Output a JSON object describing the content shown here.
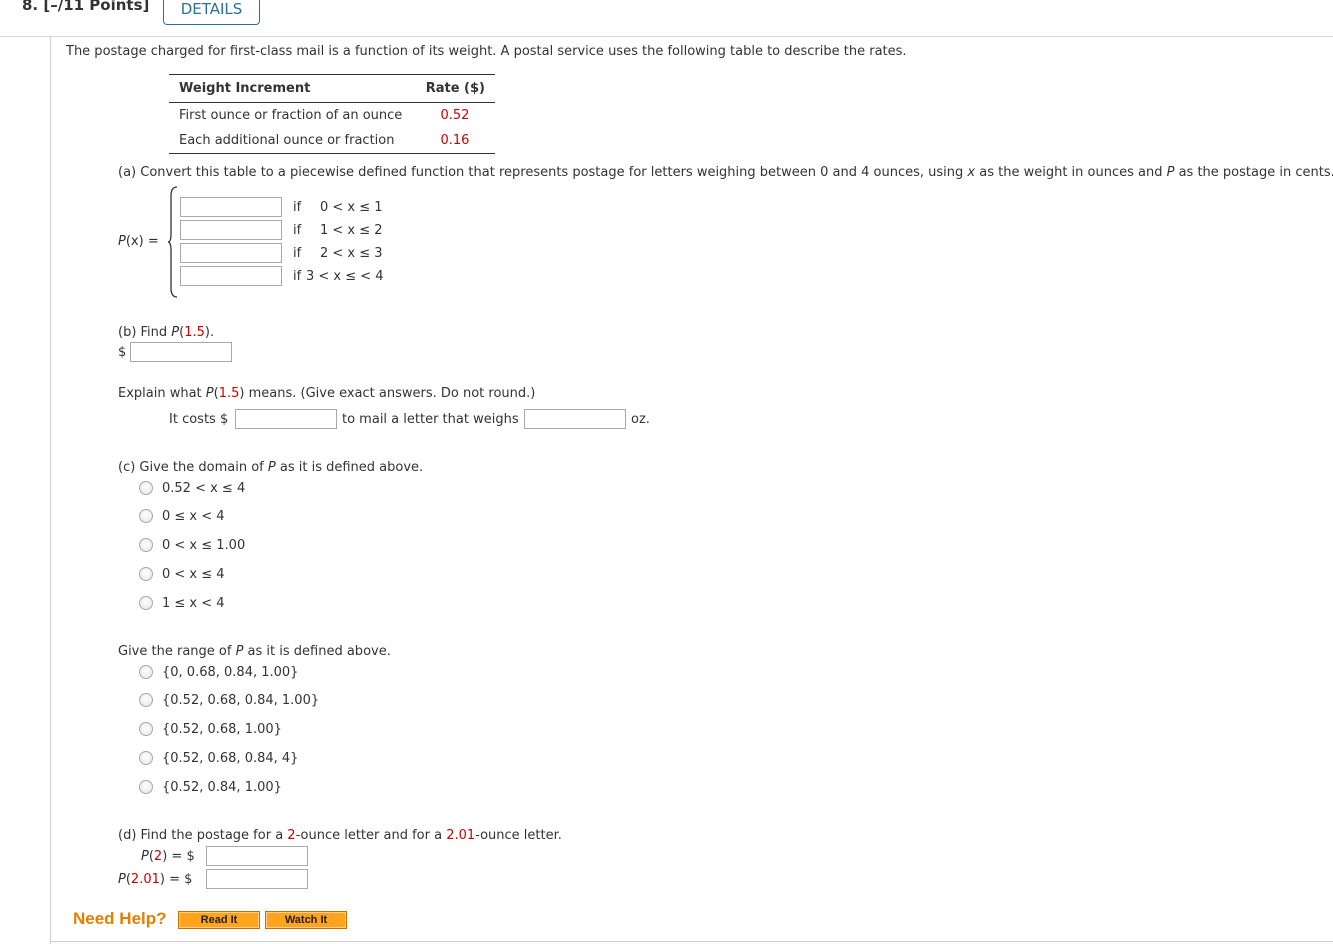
{
  "header": {
    "question_number": "8.",
    "points": "[–/11 Points]",
    "details_label": "DETAILS"
  },
  "intro": "The postage charged for first-class mail is a function of its weight. A postal service uses the following table to describe the rates.",
  "rate_table": {
    "headers": [
      "Weight Increment",
      "Rate ($)"
    ],
    "rows": [
      {
        "label": "First ounce or fraction of an ounce",
        "rate": "0.52"
      },
      {
        "label": "Each additional ounce or fraction",
        "rate": "0.16"
      }
    ]
  },
  "part_a": {
    "prompt_pre": "(a) Convert this table to a piecewise defined function that represents postage for letters weighing between 0 and 4 ounces, using ",
    "var_x": "x",
    "prompt_mid": " as the weight in ounces and ",
    "var_p": "P",
    "prompt_post": " as the postage in cents.",
    "function_label_p": "P",
    "function_label_rest": "(x)  =",
    "pieces": [
      {
        "if": "if",
        "condition": "0 < x ≤ 1",
        "value": ""
      },
      {
        "if": "if",
        "condition": "1 < x ≤ 2",
        "value": ""
      },
      {
        "if": "if",
        "condition": "2 < x ≤ 3",
        "value": ""
      },
      {
        "if": "if",
        "condition": "3 < x ≤ < 4",
        "value": ""
      }
    ]
  },
  "part_b": {
    "prompt_pre": "(b) Find ",
    "func": "P",
    "open": "(",
    "arg": "1.5",
    "close": ").",
    "dollar": "$",
    "answer": "",
    "explain_pre": "Explain what ",
    "explain_func": "P",
    "explain_open": "(",
    "explain_arg": "1.5",
    "explain_post": ") means. (Give exact answers. Do not round.)",
    "sentence_start": "It costs $",
    "sentence_mid": "to mail a letter that weighs",
    "sentence_end": "oz.",
    "cost_value": "",
    "weight_value": ""
  },
  "part_c": {
    "domain_pre": "(c) Give the domain of ",
    "domain_var": "P",
    "domain_post": " as it is defined above.",
    "domain_options": [
      "0.52 < x ≤ 4",
      "0 ≤ x < 4",
      "0 < x ≤ 1.00",
      "0 < x ≤ 4",
      "1 ≤ x < 4"
    ],
    "range_pre": "Give the range of ",
    "range_var": "P",
    "range_post": " as it is defined above.",
    "range_options": [
      "{0, 0.68, 0.84, 1.00}",
      "{0.52, 0.68, 0.84, 1.00}",
      "{0.52, 0.68, 1.00}",
      "{0.52, 0.68, 0.84, 4}",
      "{0.52, 0.84, 1.00}"
    ]
  },
  "part_d": {
    "prompt_pre": "(d) Find the postage for a ",
    "w1": "2",
    "prompt_mid": "-ounce letter and for a ",
    "w2": "2.01",
    "prompt_post": "-ounce letter.",
    "row1": {
      "func": "P",
      "open": "(",
      "arg": "2",
      "close": ")",
      "eq": "=  $",
      "value": ""
    },
    "row2": {
      "func": "P",
      "open": "(",
      "arg": "2.01",
      "close": ")",
      "eq": "=  $",
      "value": ""
    }
  },
  "help": {
    "label": "Need Help?",
    "read_it": "Read It",
    "watch_it": "Watch It"
  }
}
